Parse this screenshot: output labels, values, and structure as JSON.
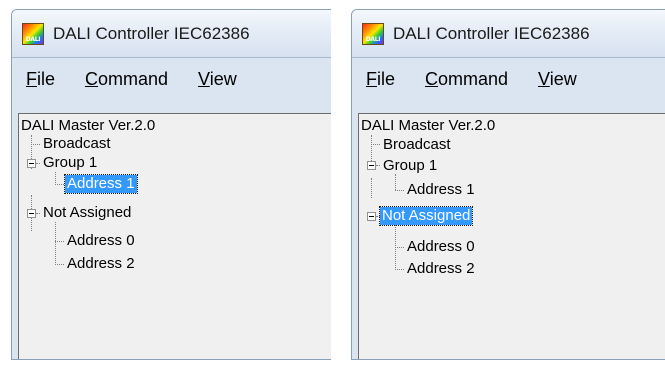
{
  "windows": [
    {
      "title": "DALI Controller IEC62386",
      "icon": {
        "name": "dali-app-icon",
        "label": "DALI"
      },
      "menu": [
        {
          "accel": "F",
          "rest": "ile"
        },
        {
          "accel": "C",
          "rest": "ommand"
        },
        {
          "accel": "V",
          "rest": "iew"
        }
      ],
      "tree": {
        "root": "DALI Master Ver.2.0",
        "broadcast": "Broadcast",
        "group": "Group 1",
        "group_child": "Address 1",
        "unassigned": "Not Assigned",
        "unassigned_children": [
          "Address 0",
          "Address 2"
        ],
        "selected": "Address 1"
      }
    },
    {
      "title": "DALI Controller IEC62386",
      "icon": {
        "name": "dali-app-icon",
        "label": "DALI"
      },
      "menu": [
        {
          "accel": "F",
          "rest": "ile"
        },
        {
          "accel": "C",
          "rest": "ommand"
        },
        {
          "accel": "V",
          "rest": "iew"
        }
      ],
      "tree": {
        "root": "DALI Master Ver.2.0",
        "broadcast": "Broadcast",
        "group": "Group 1",
        "group_child": "Address 1",
        "unassigned": "Not Assigned",
        "unassigned_children": [
          "Address 0",
          "Address 2"
        ],
        "selected": "Not Assigned"
      }
    }
  ],
  "colors": {
    "selection": "#3399ff",
    "title_bar": "#dbe5f1",
    "tree_background": "#f0f0f0"
  }
}
